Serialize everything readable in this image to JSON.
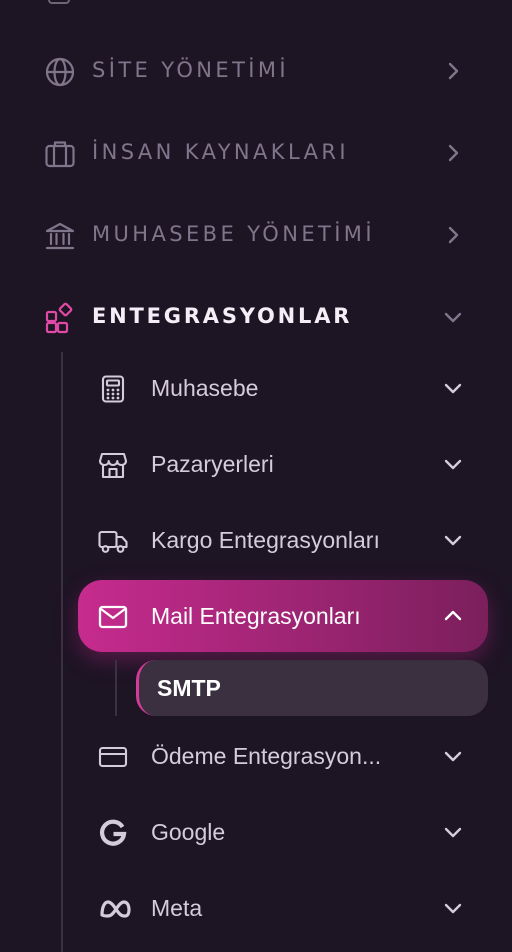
{
  "sections": [
    {
      "id": "site",
      "label": "SİTE YÖNETİMİ",
      "icon": "globe-icon"
    },
    {
      "id": "hr",
      "label": "İNSAN KAYNAKLARI",
      "icon": "briefcase-icon"
    },
    {
      "id": "accounting",
      "label": "MUHASEBE YÖNETİMİ",
      "icon": "bank-icon"
    },
    {
      "id": "integrations",
      "label": "ENTEGRASYONLAR",
      "icon": "integrations-icon"
    }
  ],
  "integration_items": [
    {
      "label": "Muhasebe",
      "icon": "calculator-icon"
    },
    {
      "label": "Pazaryerleri",
      "icon": "store-icon"
    },
    {
      "label": "Kargo Entegrasyonları",
      "icon": "truck-icon"
    },
    {
      "label": "Mail Entegrasyonları",
      "icon": "mail-icon",
      "active": true
    },
    {
      "label": "Ödeme Entegrasyon...",
      "icon": "credit-card-icon"
    },
    {
      "label": "Google",
      "icon": "google-icon"
    },
    {
      "label": "Meta",
      "icon": "meta-icon"
    }
  ],
  "mail_subitems": [
    {
      "label": "SMTP",
      "active": true
    }
  ],
  "colors": {
    "background": "#1d1424",
    "accent": "#c62b8e",
    "muted_text": "#80768b",
    "icon_pink": "#e04aa6"
  }
}
